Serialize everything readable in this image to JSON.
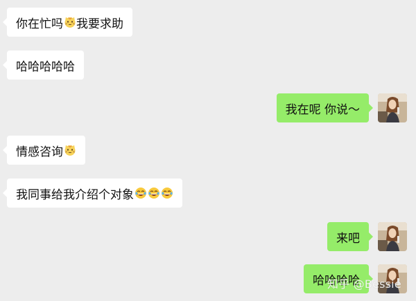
{
  "chat": {
    "messages": [
      {
        "side": "in",
        "segments": [
          {
            "t": "text",
            "v": "你在忙吗"
          },
          {
            "t": "emoji",
            "v": "cat-emoji"
          },
          {
            "t": "text",
            "v": "我要求助"
          }
        ]
      },
      {
        "side": "in",
        "segments": [
          {
            "t": "text",
            "v": "哈哈哈哈哈"
          }
        ]
      },
      {
        "side": "out",
        "segments": [
          {
            "t": "text",
            "v": "我在呢 你说～"
          }
        ]
      },
      {
        "side": "in",
        "segments": [
          {
            "t": "text",
            "v": "情感咨询"
          },
          {
            "t": "emoji",
            "v": "cat-emoji"
          }
        ]
      },
      {
        "side": "in",
        "segments": [
          {
            "t": "text",
            "v": "我同事给我介绍个对象"
          },
          {
            "t": "emoji",
            "v": "laugh-emoji"
          },
          {
            "t": "emoji",
            "v": "laugh-emoji"
          },
          {
            "t": "emoji",
            "v": "laugh-emoji"
          }
        ]
      },
      {
        "side": "out",
        "segments": [
          {
            "t": "text",
            "v": "来吧"
          }
        ]
      },
      {
        "side": "out",
        "segments": [
          {
            "t": "text",
            "v": "哈哈哈哈"
          }
        ]
      }
    ]
  },
  "watermark": "知乎 @Bessie",
  "colors": {
    "background": "#ededed",
    "incoming_bubble": "#ffffff",
    "outgoing_bubble": "#95ec69"
  }
}
